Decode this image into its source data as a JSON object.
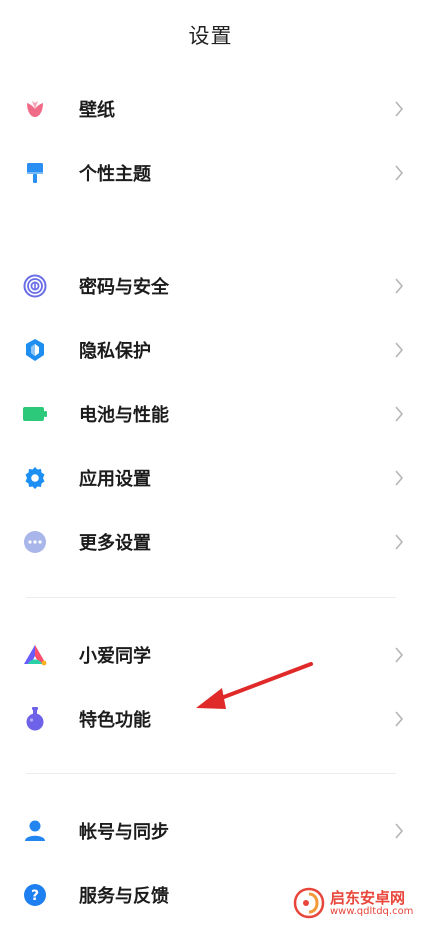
{
  "header": {
    "title": "设置"
  },
  "groups": [
    {
      "items": [
        {
          "id": "wallpaper",
          "label": "壁纸",
          "icon": "tulip-icon",
          "color": "#f06b88"
        },
        {
          "id": "theme",
          "label": "个性主题",
          "icon": "paint-brush-icon",
          "color": "#2b8ef2"
        }
      ]
    },
    {
      "items": [
        {
          "id": "password",
          "label": "密码与安全",
          "icon": "fingerprint-icon",
          "color": "#6a6ee6"
        },
        {
          "id": "privacy",
          "label": "隐私保护",
          "icon": "shield-icon",
          "color": "#1f8ef1"
        },
        {
          "id": "battery",
          "label": "电池与性能",
          "icon": "battery-icon",
          "color": "#2dc97b"
        },
        {
          "id": "apps",
          "label": "应用设置",
          "icon": "gear-icon",
          "color": "#1e8ff2"
        },
        {
          "id": "more",
          "label": "更多设置",
          "icon": "more-dots-icon",
          "color": "#8fa3e6"
        }
      ]
    },
    {
      "items": [
        {
          "id": "xiaoai",
          "label": "小爱同学",
          "icon": "xiaoai-icon",
          "color": "#6a5cff"
        },
        {
          "id": "special",
          "label": "特色功能",
          "icon": "flask-icon",
          "color": "#6e62e8"
        }
      ]
    },
    {
      "items": [
        {
          "id": "account",
          "label": "帐号与同步",
          "icon": "user-icon",
          "color": "#2386f0"
        },
        {
          "id": "feedback",
          "label": "服务与反馈",
          "icon": "help-icon",
          "color": "#1e7ff0"
        }
      ]
    }
  ],
  "annotation": {
    "color": "#e02a2a"
  },
  "watermark": {
    "name": "启东安卓网",
    "url": "www.qdltdq.com",
    "color": "#e8463b"
  }
}
